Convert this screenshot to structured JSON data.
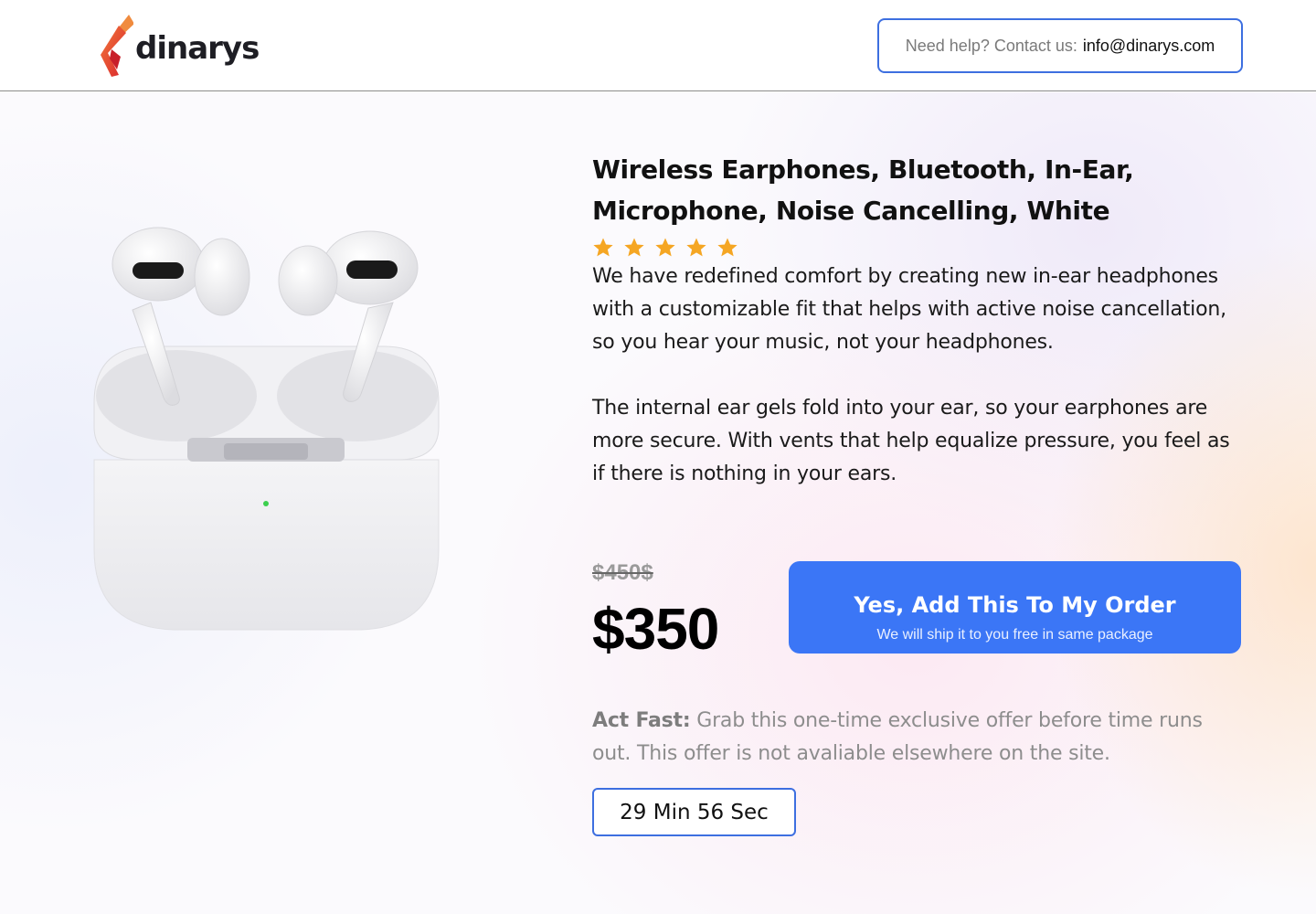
{
  "brand": {
    "name": "dinarys",
    "accent": "#e8423a"
  },
  "header": {
    "help_prefix": "Need help? Contact us:",
    "help_email": "info@dinarys.com"
  },
  "product": {
    "image_icon": "airpods-pro-icon",
    "title": "Wireless Earphones, Bluetooth, In-Ear, Microphone, Noise Cancelling, White",
    "rating": 5,
    "rating_max": 5,
    "star_color": "#f5a623",
    "description": [
      "We have redefined comfort by creating new in-ear headphones with a customizable fit that helps with active noise cancellation, so you hear your music, not your headphones.",
      "The internal ear gels fold into your ear, so your earphones are more secure. With vents that help equalize pressure, you feel as if there is nothing in your ears."
    ],
    "old_price": "$450$",
    "price": "$350"
  },
  "cta": {
    "title": "Yes, Add This To My Order",
    "subtitle": "We will ship it to you free in same package",
    "color": "#3b76f6"
  },
  "offer": {
    "label": "Act Fast:",
    "text": "Grab this one-time exclusive offer before time runs out. This offer is not avaliable elsewhere on the site."
  },
  "timer": {
    "text": "29 Min 56 Sec"
  }
}
